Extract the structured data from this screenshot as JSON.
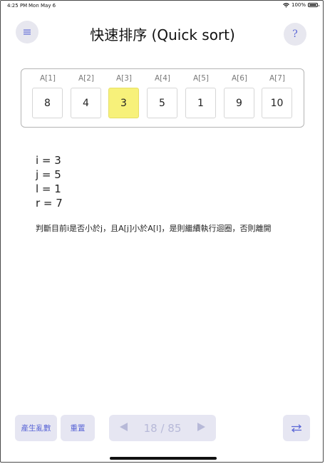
{
  "status_bar": {
    "time": "4:25 PM",
    "date": "Mon May 6",
    "battery": "100%"
  },
  "header": {
    "title": "快速排序 (Quick sort)",
    "menu_icon": "hamburger-icon",
    "help_label": "?"
  },
  "array": {
    "cells": [
      {
        "label": "A[1]",
        "value": "8",
        "highlighted": false
      },
      {
        "label": "A[2]",
        "value": "4",
        "highlighted": false
      },
      {
        "label": "A[3]",
        "value": "3",
        "highlighted": true
      },
      {
        "label": "A[4]",
        "value": "5",
        "highlighted": false
      },
      {
        "label": "A[5]",
        "value": "1",
        "highlighted": false
      },
      {
        "label": "A[6]",
        "value": "9",
        "highlighted": false
      },
      {
        "label": "A[7]",
        "value": "10",
        "highlighted": false
      }
    ],
    "highlight_color": "#f7f17a"
  },
  "variables": {
    "i": "i = 3",
    "j": "j = 5",
    "l": "l = 1",
    "r": "r = 7"
  },
  "description": "判斷目前i是否小於j，且A[j]小於A[l]，是則繼續執行迴圈，否則離開",
  "toolbar": {
    "random_label": "產生亂數",
    "reset_label": "重置",
    "prev_icon": "triangle-left-icon",
    "page_text": "18 / 85",
    "next_icon": "triangle-right-icon",
    "swap_icon": "swap-arrows-icon"
  },
  "colors": {
    "accent": "#5a66d6",
    "button_bg": "#e6e6f2"
  }
}
